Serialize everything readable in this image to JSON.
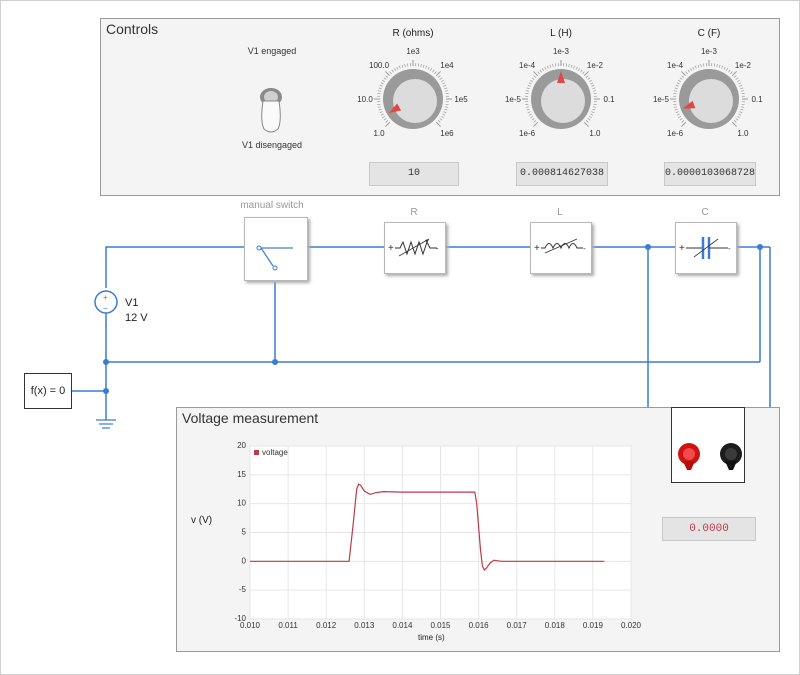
{
  "controls": {
    "title": "Controls",
    "switch": {
      "engaged_label": "V1 engaged",
      "disengaged_label": "V1 disengaged"
    },
    "knobs": [
      {
        "title": "R (ohms)",
        "scale_labels": [
          "1.0",
          "10.0",
          "100.0",
          "1e3",
          "1e4",
          "1e5",
          "1e6"
        ],
        "readout": "10"
      },
      {
        "title": "L (H)",
        "scale_labels": [
          "1e-6",
          "1e-5",
          "1e-4",
          "1e-3",
          "1e-2",
          "0.1",
          "1.0"
        ],
        "readout": "0.000814627038"
      },
      {
        "title": "C (F)",
        "scale_labels": [
          "1e-6",
          "1e-5",
          "1e-4",
          "1e-3",
          "1e-2",
          "0.1",
          "1.0"
        ],
        "readout": "0.0000103068728"
      }
    ]
  },
  "circuit": {
    "manual_switch_label": "manual switch",
    "resistor_label": "R",
    "inductor_label": "L",
    "capacitor_label": "C",
    "source_name": "V1",
    "source_value": "12 V",
    "function_block": "f(x) = 0",
    "meter_readout": "0.0000"
  },
  "colors": {
    "wire": "#3a7bd5",
    "trace": "#c0394b",
    "needle": "#e04848"
  },
  "measurement": {
    "title": "Voltage measurement",
    "chart_data": {
      "type": "line",
      "title": "",
      "xlabel": "time (s)",
      "ylabel": "v (V)",
      "xlim": [
        0.01,
        0.02
      ],
      "ylim": [
        -10,
        20
      ],
      "x_ticks": [
        "0.010",
        "0.011",
        "0.012",
        "0.013",
        "0.014",
        "0.015",
        "0.016",
        "0.017",
        "0.018",
        "0.019",
        "0.020"
      ],
      "y_ticks": [
        "-10",
        "-5",
        "0",
        "5",
        "10",
        "15",
        "20"
      ],
      "grid": true,
      "legend_position": "top-left",
      "series": [
        {
          "name": "voltage",
          "x": [
            0.01,
            0.0126,
            0.0127,
            0.0128,
            0.01285,
            0.0129,
            0.013,
            0.01315,
            0.0133,
            0.0135,
            0.014,
            0.015,
            0.0159,
            0.01595,
            0.016,
            0.01605,
            0.0161,
            0.01615,
            0.0162,
            0.0163,
            0.0164,
            0.0166,
            0.017,
            0.018,
            0.019,
            0.0193
          ],
          "y": [
            0,
            0,
            6,
            12.5,
            13.4,
            13.2,
            12.2,
            11.6,
            11.9,
            12.1,
            12,
            12,
            12,
            10,
            6,
            2,
            -0.8,
            -1.5,
            -1.2,
            -0.3,
            0.2,
            0,
            0,
            0,
            0,
            0
          ]
        }
      ]
    }
  }
}
